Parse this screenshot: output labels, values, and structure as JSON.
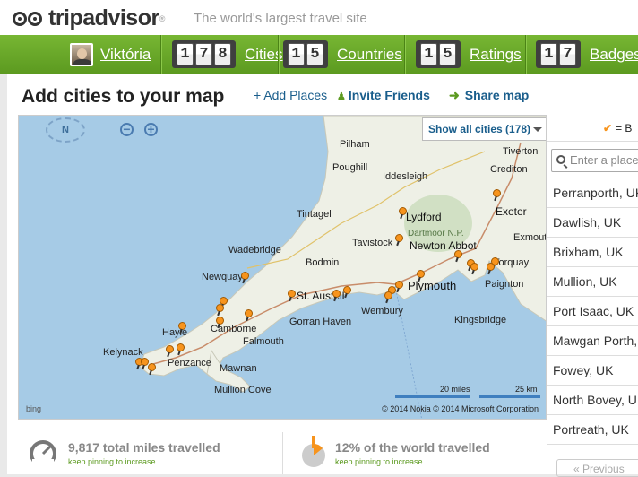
{
  "header": {
    "logo_trip": "trip",
    "logo_advisor": "advisor",
    "logo_reg": "®",
    "tagline": "The world's largest travel site"
  },
  "greenbar": {
    "user_name": "Viktória",
    "cities": {
      "digits": [
        "1",
        "7",
        "8"
      ],
      "label": "Cities"
    },
    "countries": {
      "digits": [
        "1",
        "5"
      ],
      "label": "Countries"
    },
    "ratings": {
      "digits": [
        "1",
        "5"
      ],
      "label": "Ratings"
    },
    "badges": {
      "digits": [
        "1",
        "7"
      ],
      "label": "Badges"
    }
  },
  "main": {
    "title": "Add cities to your map",
    "add_places": "+ Add Places",
    "invite_friends": "Invite Friends",
    "share_map": "Share map"
  },
  "map": {
    "compass": "N",
    "zoom_out": "−",
    "zoom_in": "+",
    "show_all": "Show all cities  (178)",
    "places": [
      "Pilham",
      "Poughill",
      "Crediton",
      "Tiverton",
      "Iddesleigh",
      "Tintagel",
      "Lydford",
      "Exeter",
      "Dartmoor N.P.",
      "Tavistock",
      "Newton Abbot",
      "Exmouth",
      "Wadebridge",
      "Bodmin",
      "Torquay",
      "Newquay",
      "St. Austell",
      "Plymouth",
      "Paignton",
      "Hayle",
      "Camborne",
      "Gorran Haven",
      "Wembury",
      "Kingsbridge",
      "Falmouth",
      "Kelynack",
      "Penzance",
      "Mawnan",
      "Mullion Cove"
    ],
    "scale_miles": "20 miles",
    "scale_km": "25 km",
    "copyright": "© 2014 Nokia   © 2014 Microsoft Corporation",
    "bing": "bing"
  },
  "sidebar": {
    "head_check": "✔",
    "head_text": "= B",
    "search_placeholder": "Enter a place",
    "items": [
      "Perranporth, UK",
      "Dawlish, UK",
      "Brixham, UK",
      "Mullion, UK",
      "Port Isaac, UK",
      "Mawgan Porth, U",
      "Fowey, UK",
      "North Bovey, UK",
      "Portreath, UK"
    ],
    "prev": "« Previous"
  },
  "stats": {
    "miles": {
      "value": "9,817 total miles travelled",
      "sub": "keep pinning to increase"
    },
    "world": {
      "value": "12% of the world travelled",
      "sub": "keep pinning to increase"
    }
  },
  "colors": {
    "green": "#6aa82a",
    "orange": "#f7941d",
    "link": "#1a5e8c",
    "sea": "#a6cbe6"
  }
}
